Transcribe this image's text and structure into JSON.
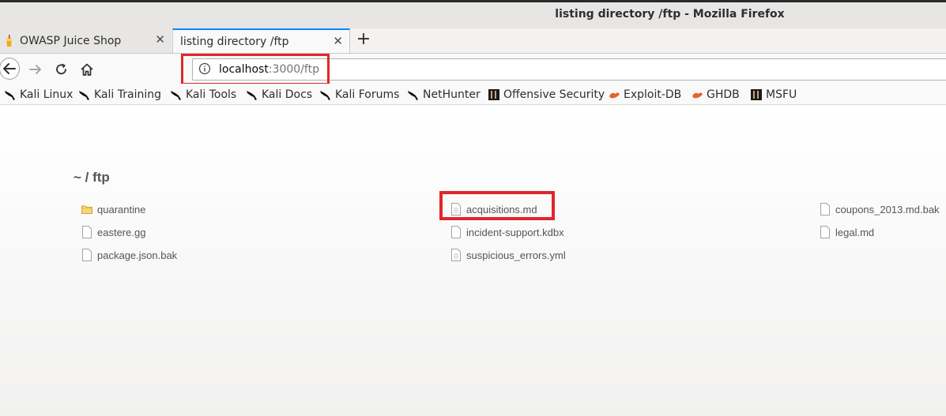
{
  "window": {
    "title": "listing directory /ftp - Mozilla Firefox"
  },
  "tabs": [
    {
      "title": "OWASP Juice Shop",
      "close": "✕",
      "icon": "juice-shop-favicon"
    },
    {
      "title": "listing directory /ftp",
      "close": "✕",
      "active": true
    }
  ],
  "new_tab_label": "+",
  "url": {
    "host": "localhost",
    "path": ":3000/ftp"
  },
  "bookmarks": [
    {
      "label": "Kali Linux",
      "icon": "kali-dragon-icon"
    },
    {
      "label": "Kali Training",
      "icon": "kali-dragon-icon"
    },
    {
      "label": "Kali Tools",
      "icon": "kali-dragon-icon"
    },
    {
      "label": "Kali Docs",
      "icon": "kali-dragon-icon"
    },
    {
      "label": "Kali Forums",
      "icon": "kali-dragon-icon"
    },
    {
      "label": "NetHunter",
      "icon": "kali-dragon-icon"
    },
    {
      "label": "Offensive Security",
      "icon": "offsec-icon"
    },
    {
      "label": "Exploit-DB",
      "icon": "exploit-db-icon"
    },
    {
      "label": "GHDB",
      "icon": "exploit-db-icon"
    },
    {
      "label": "MSFU",
      "icon": "offsec-icon"
    }
  ],
  "listing": {
    "heading": "~ / ftp",
    "files": [
      {
        "name": "quarantine",
        "type": "folder"
      },
      {
        "name": "acquisitions.md",
        "type": "file"
      },
      {
        "name": "coupons_2013.md.bak",
        "type": "file"
      },
      {
        "name": "eastere.gg",
        "type": "file"
      },
      {
        "name": "incident-support.kdbx",
        "type": "file"
      },
      {
        "name": "legal.md",
        "type": "file"
      },
      {
        "name": "package.json.bak",
        "type": "file"
      },
      {
        "name": "suspicious_errors.yml",
        "type": "file"
      }
    ]
  },
  "colors": {
    "highlight": "#e0262b",
    "active_tab_accent": "#0a84ff"
  }
}
